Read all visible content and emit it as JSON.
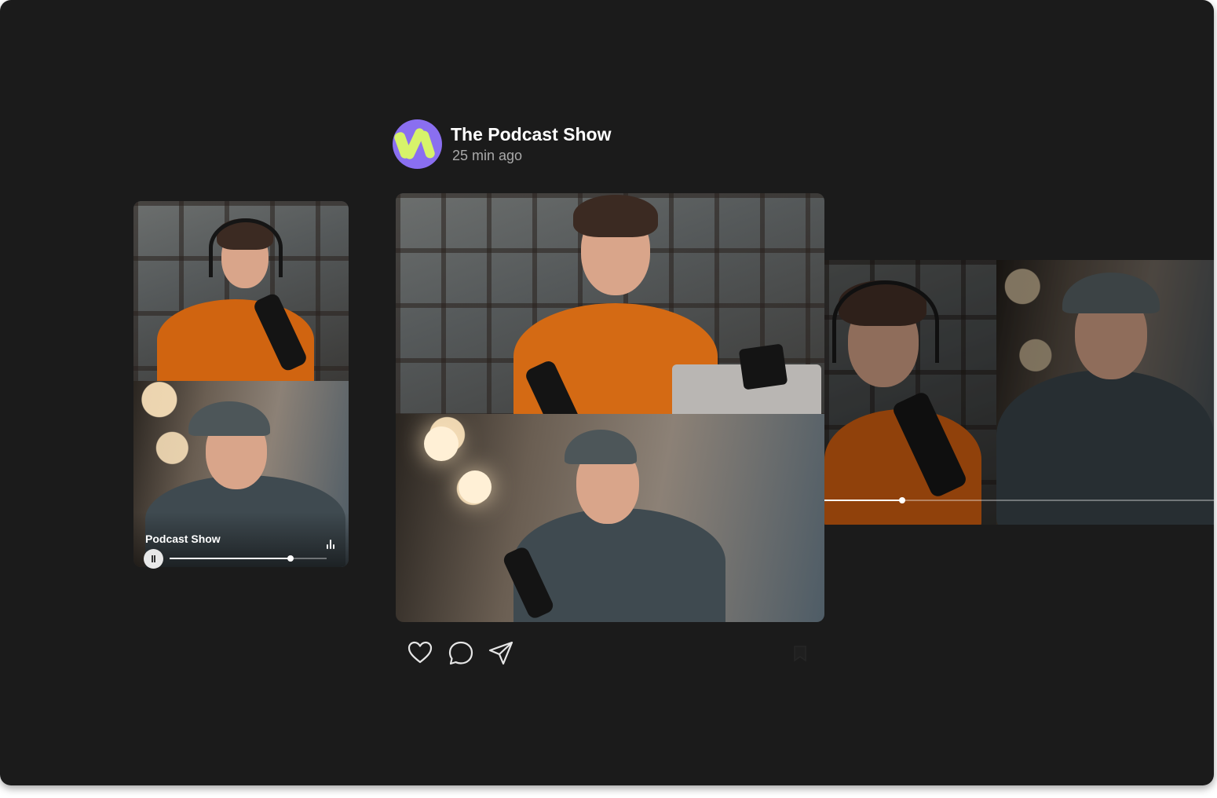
{
  "post": {
    "author": "The Podcast Show",
    "time": "25 min ago",
    "avatar_colors": {
      "bg": "#8a6ff0",
      "stripe": "#d7f36a"
    }
  },
  "left_card": {
    "player_title": "Podcast Show",
    "progress": 0.77,
    "playing": true,
    "icons": [
      "pause-icon",
      "waveform-icon"
    ]
  },
  "right_card": {
    "progress": 0.2
  },
  "actions": [
    "heart-icon",
    "comment-icon",
    "share-icon",
    "bookmark-icon"
  ],
  "colors": {
    "frame_bg": "#1b1b1b",
    "text_primary": "#ffffff",
    "text_secondary": "#a9a9a9",
    "shirt_orange": "#d46a14",
    "shirt_gray": "#3f4a50"
  }
}
